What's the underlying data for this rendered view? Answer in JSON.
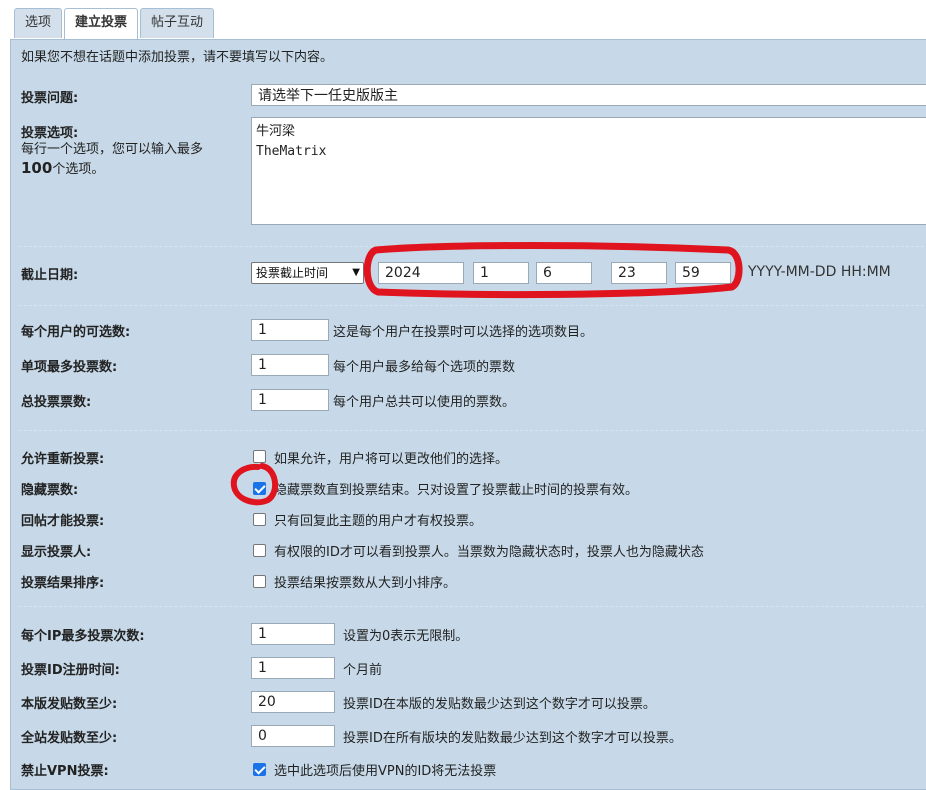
{
  "tabs": [
    "选项",
    "建立投票",
    "帖子互动"
  ],
  "intro": "如果您不想在话题中添加投票，请不要填写以下内容。",
  "question": {
    "label": "投票问题:",
    "value": "请选举下一任史版版主"
  },
  "options": {
    "label": "投票选项:",
    "help_line1": "每行一个选项，您可以输入最多",
    "help_max": "100",
    "help_line3": "个选项。",
    "value": "牛河梁\nTheMatrix"
  },
  "deadline": {
    "label": "截止日期:",
    "select_value": "投票截止时间",
    "year": "2024",
    "month": "1",
    "day": "6",
    "hour": "23",
    "minute": "59",
    "format": "YYYY-MM-DD HH:MM"
  },
  "limits": [
    {
      "label": "每个用户的可选数:",
      "value": "1",
      "hint": "这是每个用户在投票时可以选择的选项数目。"
    },
    {
      "label": "单项最多投票数:",
      "value": "1",
      "hint": "每个用户最多给每个选项的票数"
    },
    {
      "label": "总投票票数:",
      "value": "1",
      "hint": "每个用户总共可以使用的票数。"
    }
  ],
  "checks": [
    {
      "label": "允许重新投票:",
      "text": "如果允许，用户将可以更改他们的选择。",
      "checked": false
    },
    {
      "label": "隐藏票数:",
      "text": "隐藏票数直到投票结束。只对设置了投票截止时间的投票有效。",
      "checked": true
    },
    {
      "label": "回帖才能投票:",
      "text": "只有回复此主题的用户才有权投票。",
      "checked": false
    },
    {
      "label": "显示投票人:",
      "text": "有权限的ID才可以看到投票人。当票数为隐藏状态时，投票人也为隐藏状态",
      "checked": false
    },
    {
      "label": "投票结果排序:",
      "text": "投票结果按票数从大到小排序。",
      "checked": false
    }
  ],
  "restrictions": [
    {
      "label": "每个IP最多投票次数:",
      "value": "1",
      "hint": "设置为0表示无限制。"
    },
    {
      "label": "投票ID注册时间:",
      "value": "1",
      "hint": "个月前"
    },
    {
      "label": "本版发贴数至少:",
      "value": "20",
      "hint": "投票ID在本版的发贴数最少达到这个数字才可以投票。"
    },
    {
      "label": "全站发贴数至少:",
      "value": "0",
      "hint": "投票ID在所有版块的发贴数最少达到这个数字才可以投票。"
    }
  ],
  "vpn": {
    "label": "禁止VPN投票:",
    "text": "选中此选项后使用VPN的ID将无法投票",
    "checked": true
  },
  "colors": {
    "panel": "#c7d9e8",
    "annotation": "#e0141e",
    "checkbox": "#1a73e8"
  }
}
